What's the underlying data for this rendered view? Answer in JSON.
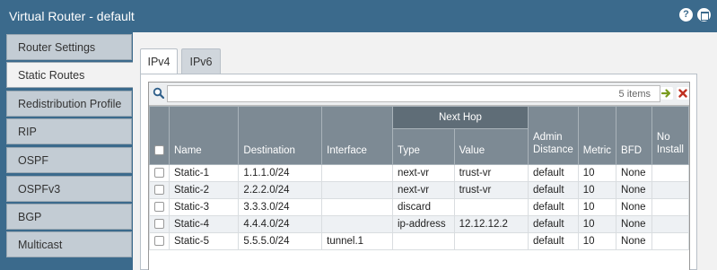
{
  "window": {
    "title": "Virtual Router - default"
  },
  "sidebar": {
    "items": [
      {
        "label": "Router Settings"
      },
      {
        "label": "Static Routes"
      },
      {
        "label": "Redistribution Profile"
      },
      {
        "label": "RIP"
      },
      {
        "label": "OSPF"
      },
      {
        "label": "OSPFv3"
      },
      {
        "label": "BGP"
      },
      {
        "label": "Multicast"
      }
    ],
    "active": "Static Routes"
  },
  "tabs": [
    {
      "label": "IPv4"
    },
    {
      "label": "IPv6"
    }
  ],
  "active_tab": "IPv4",
  "filter": {
    "value": "",
    "count_label": "5 items"
  },
  "table": {
    "group_header": "Next Hop",
    "headers": {
      "name": "Name",
      "destination": "Destination",
      "interface": "Interface",
      "type": "Type",
      "value": "Value",
      "admin_distance": "Admin Distance",
      "metric": "Metric",
      "bfd": "BFD",
      "no_install": "No Install"
    },
    "rows": [
      {
        "name": "Static-1",
        "destination": "1.1.1.0/24",
        "interface": "",
        "type": "next-vr",
        "value": "trust-vr",
        "admin_distance": "default",
        "metric": "10",
        "bfd": "None",
        "no_install": ""
      },
      {
        "name": "Static-2",
        "destination": "2.2.2.0/24",
        "interface": "",
        "type": "next-vr",
        "value": "trust-vr",
        "admin_distance": "default",
        "metric": "10",
        "bfd": "None",
        "no_install": ""
      },
      {
        "name": "Static-3",
        "destination": "3.3.3.0/24",
        "interface": "",
        "type": "discard",
        "value": "",
        "admin_distance": "default",
        "metric": "10",
        "bfd": "None",
        "no_install": ""
      },
      {
        "name": "Static-4",
        "destination": "4.4.4.0/24",
        "interface": "",
        "type": "ip-address",
        "value": "12.12.12.2",
        "admin_distance": "default",
        "metric": "10",
        "bfd": "None",
        "no_install": ""
      },
      {
        "name": "Static-5",
        "destination": "5.5.5.0/24",
        "interface": "tunnel.1",
        "type": "",
        "value": "",
        "admin_distance": "default",
        "metric": "10",
        "bfd": "None",
        "no_install": ""
      }
    ]
  },
  "icons": {
    "search": "search-icon",
    "apply": "arrow-right-icon",
    "clear": "close-icon",
    "help": "help-icon",
    "maximize": "maximize-icon"
  },
  "colors": {
    "titlebar": "#3b6a8c",
    "header": "#7d8a94",
    "group_header": "#5f6d77",
    "apply_icon": "#7a9b1e",
    "clear_icon": "#c03020"
  }
}
